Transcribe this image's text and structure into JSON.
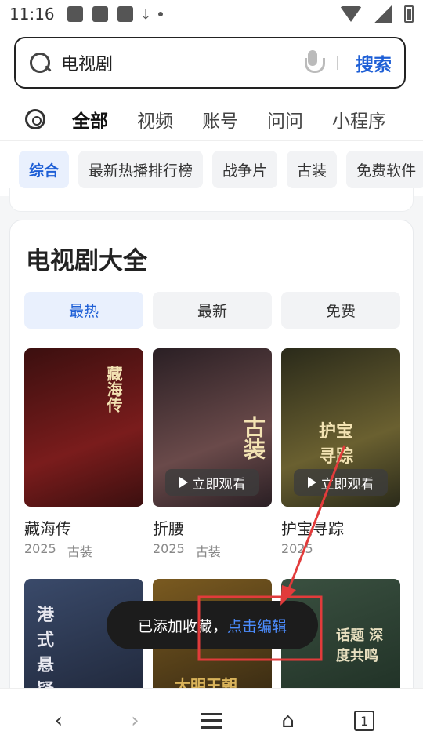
{
  "status_bar": {
    "time": "11:16"
  },
  "search": {
    "value": "电视剧",
    "button_label": "搜索"
  },
  "tabs": [
    {
      "label": "全部"
    },
    {
      "label": "视频"
    },
    {
      "label": "账号"
    },
    {
      "label": "问问"
    },
    {
      "label": "小程序"
    }
  ],
  "chips": [
    {
      "label": "综合"
    },
    {
      "label": "最新热播排行榜"
    },
    {
      "label": "战争片"
    },
    {
      "label": "古装"
    },
    {
      "label": "免费软件"
    }
  ],
  "card": {
    "title": "电视剧大全",
    "filters": [
      {
        "label": "最热"
      },
      {
        "label": "最新"
      },
      {
        "label": "免费"
      }
    ],
    "items": [
      {
        "title": "藏海传",
        "year": "2025",
        "genre": "古装",
        "poster_text": "藏海传",
        "colors": [
          "#3b0f0f",
          "#7a1c1c"
        ]
      },
      {
        "title": "折腰",
        "year": "2025",
        "genre": "古装",
        "poster_text": "古装",
        "watch_label": "立即观看",
        "colors": [
          "#2a1f24",
          "#6a4a4a"
        ]
      },
      {
        "title": "护宝寻踪",
        "year": "2025",
        "genre": "",
        "poster_text": "护宝寻踪",
        "watch_label": "立即观看",
        "colors": [
          "#2a2a1a",
          "#6a6030"
        ]
      }
    ],
    "row2": [
      {
        "poster_text": "港式悬疑",
        "colors": [
          "#1a2030",
          "#3a4a6a"
        ]
      },
      {
        "poster_text": "大明王朝",
        "colors": [
          "#2a2010",
          "#7a5a20"
        ]
      },
      {
        "poster_text": "话题 深度共鸣",
        "colors": [
          "#1a2a20",
          "#3a5040"
        ]
      }
    ]
  },
  "toast": {
    "text": "已添加收藏，",
    "link": "点击编辑"
  },
  "bottom_nav": {
    "tab_count": "1"
  }
}
